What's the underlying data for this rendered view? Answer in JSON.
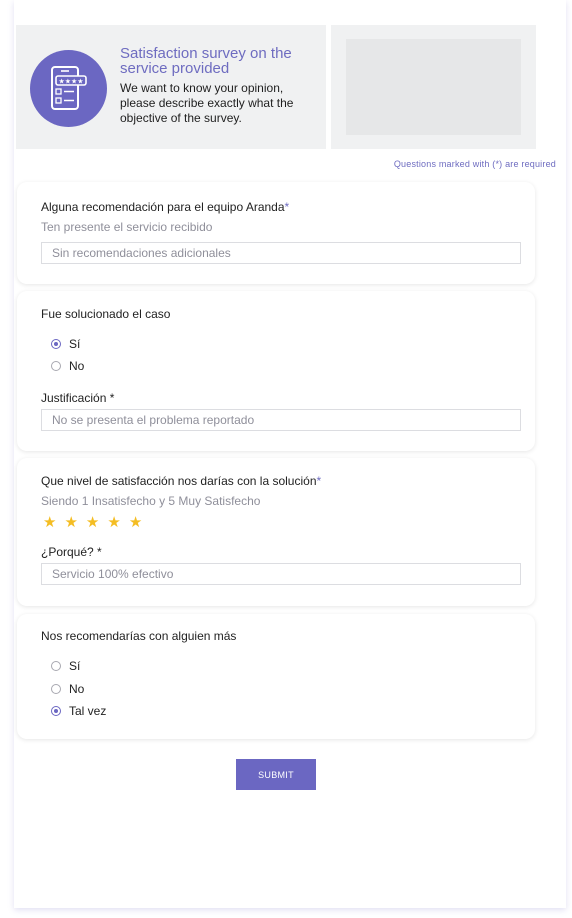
{
  "header": {
    "title": "Satisfaction survey on the service provided",
    "description": "We want to know your opinion, please describe exactly what the objective of the survey.",
    "logo_icon": "survey-phone-icon",
    "accent_color": "#6b67c2"
  },
  "required_note": "Questions marked with (*) are required",
  "q1": {
    "label": "Alguna recomendación para el equipo Aranda",
    "required_mark": "*",
    "help": "Ten presente el servicio recibido",
    "placeholder": "Sin recomendaciones adicionales"
  },
  "q2": {
    "label": "Fue solucionado el caso",
    "options": [
      "Sí",
      "No"
    ],
    "selected": "Sí",
    "justification_label": "Justificación *",
    "justification_value": "No se presenta el problema reportado"
  },
  "q3": {
    "label": "Que nivel de satisfacción nos darías con la solución",
    "required_mark": "*",
    "help": "Siendo 1 Insatisfecho y 5 Muy Satisfecho",
    "rating": 5,
    "rating_max": 5,
    "why_label": "¿Porqué? *",
    "why_value": "Servicio 100% efectivo"
  },
  "q4": {
    "label": "Nos recomendarías con alguien más",
    "options": [
      "Sí",
      "No",
      "Tal vez"
    ],
    "selected": "Tal vez"
  },
  "submit_label": "SUBMIT"
}
